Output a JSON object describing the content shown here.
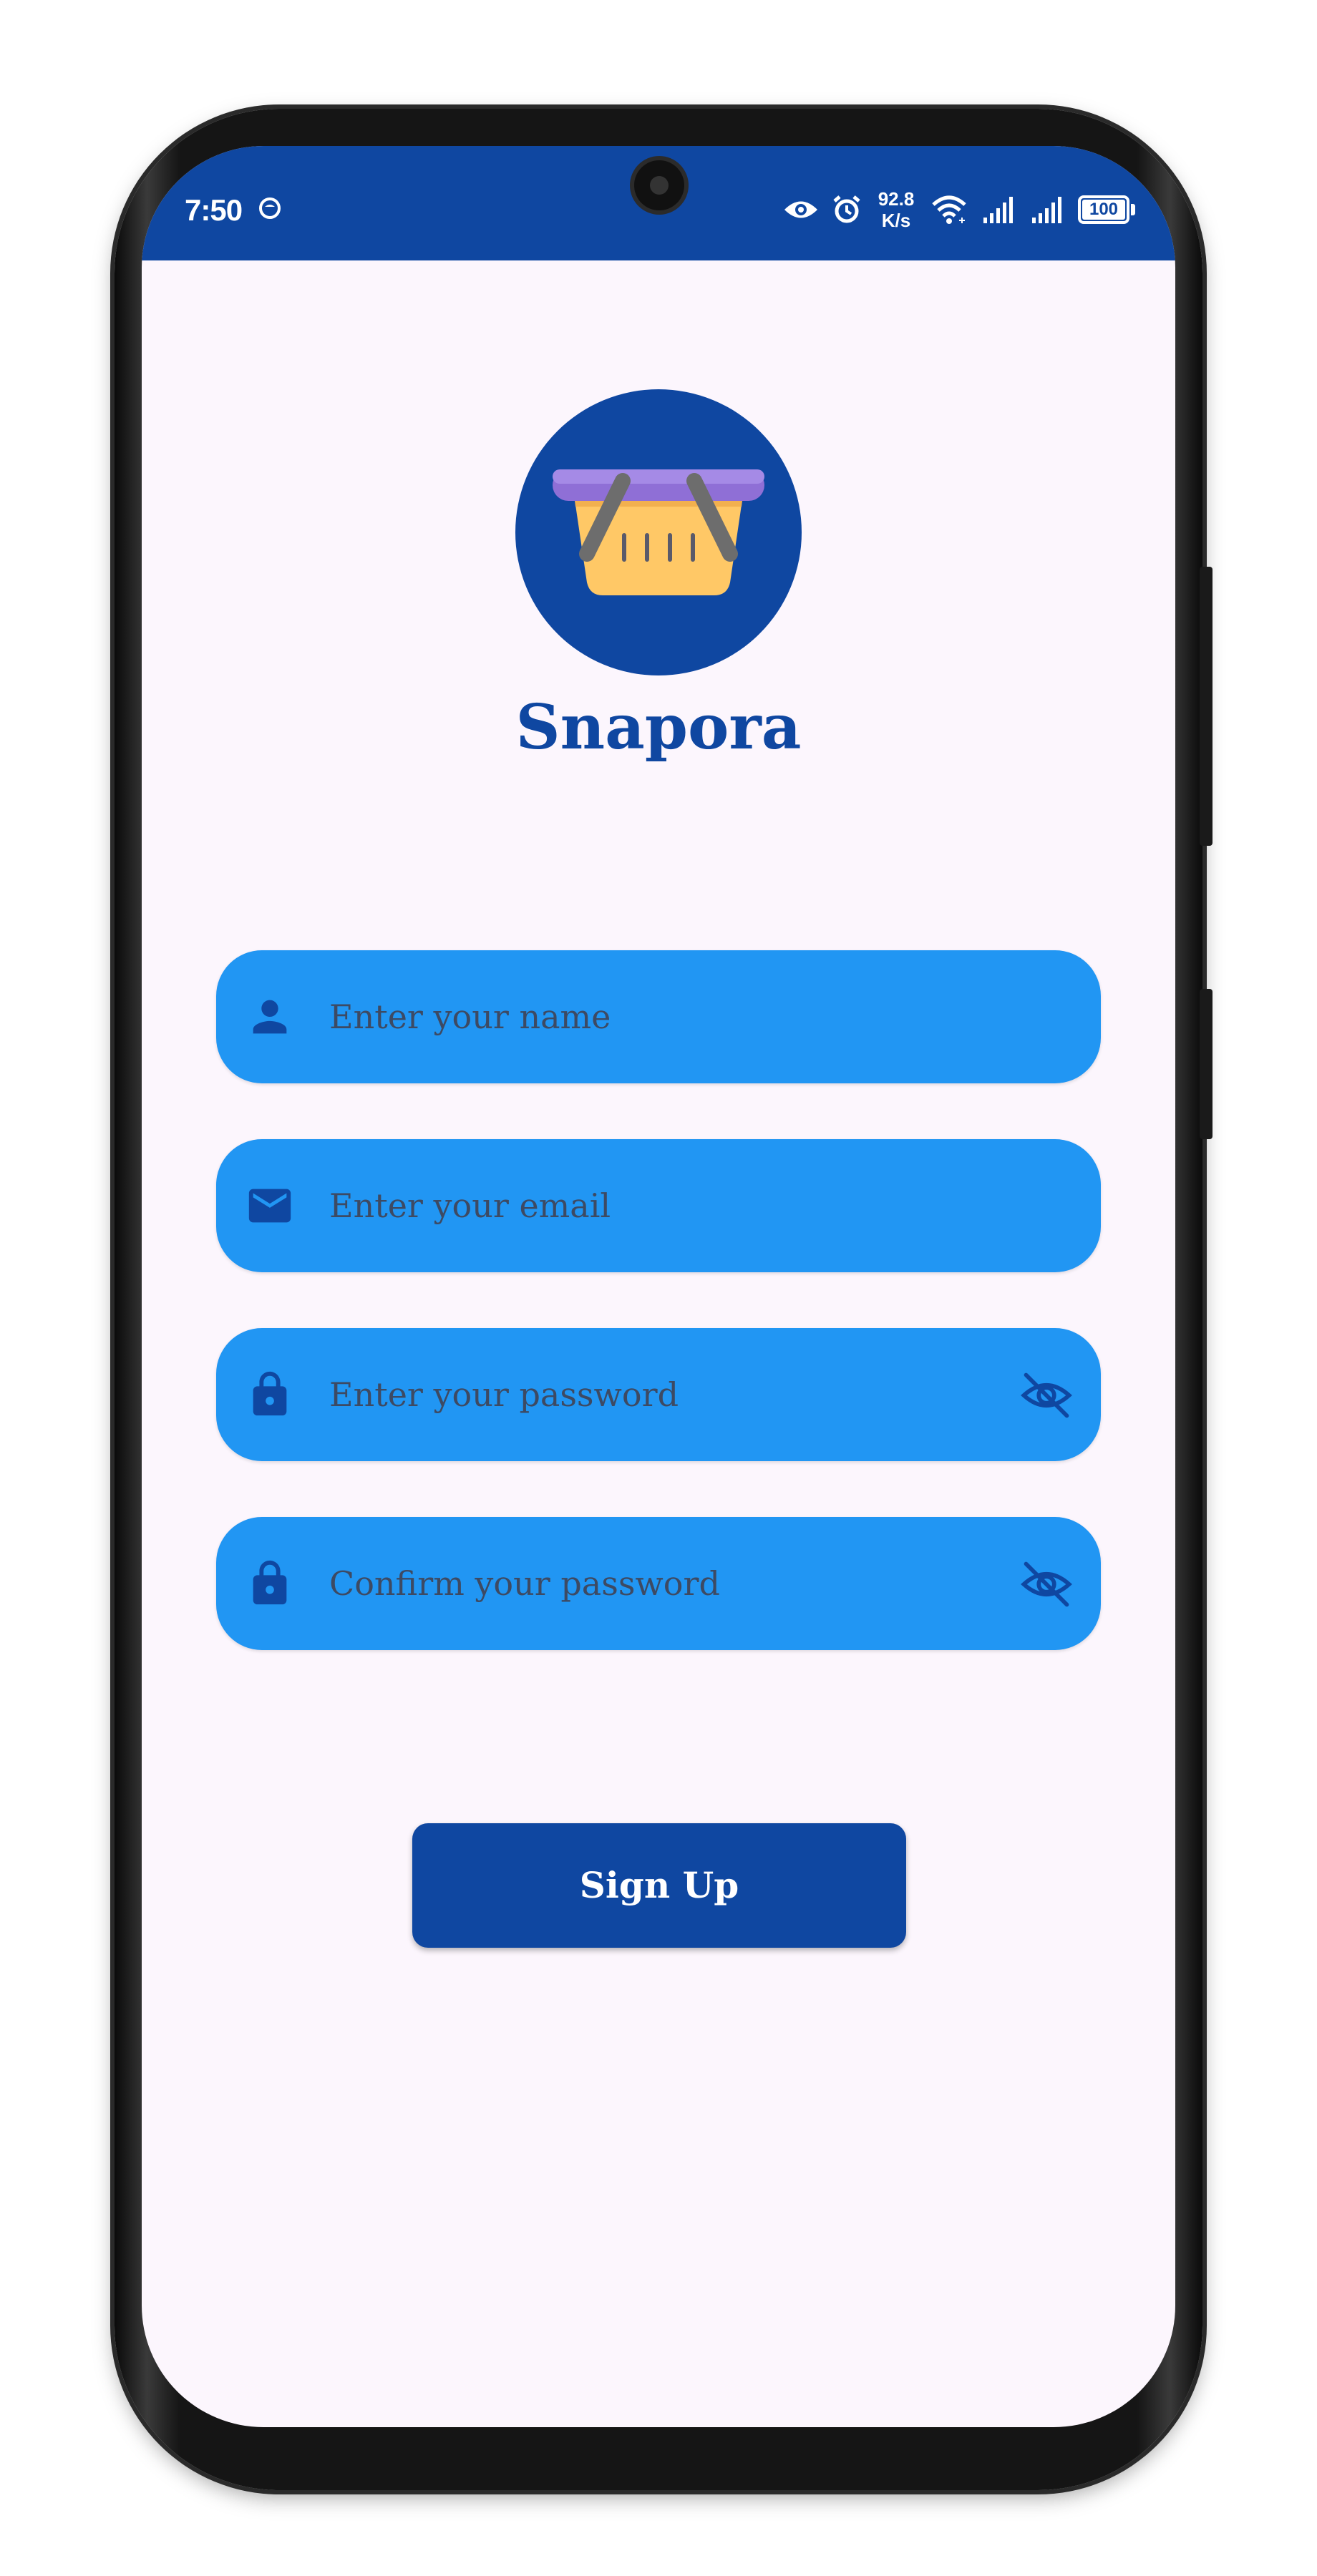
{
  "status_bar": {
    "time": "7:50",
    "speed_value": "92.8",
    "speed_unit": "K/s",
    "battery": "100",
    "icons": [
      "smiley-icon",
      "eye-icon",
      "alarm-icon",
      "wifi-icon",
      "signal-icon",
      "signal-icon",
      "battery-icon"
    ]
  },
  "app": {
    "name": "Snapora",
    "logo_icon": "shopping-basket-icon"
  },
  "form": {
    "name_placeholder": "Enter your name",
    "email_placeholder": "Enter your email",
    "password_placeholder": "Enter your password",
    "confirm_placeholder": "Confirm your password",
    "name_icon": "person-icon",
    "email_icon": "mail-icon",
    "password_icon": "lock-icon",
    "visibility_icon": "eye-off-icon",
    "submit_label": "Sign Up"
  },
  "colors": {
    "primary": "#0f47a1",
    "field_background": "#2196f3",
    "screen_background": "#fcf6fd",
    "placeholder_text": "#3d4a63"
  }
}
